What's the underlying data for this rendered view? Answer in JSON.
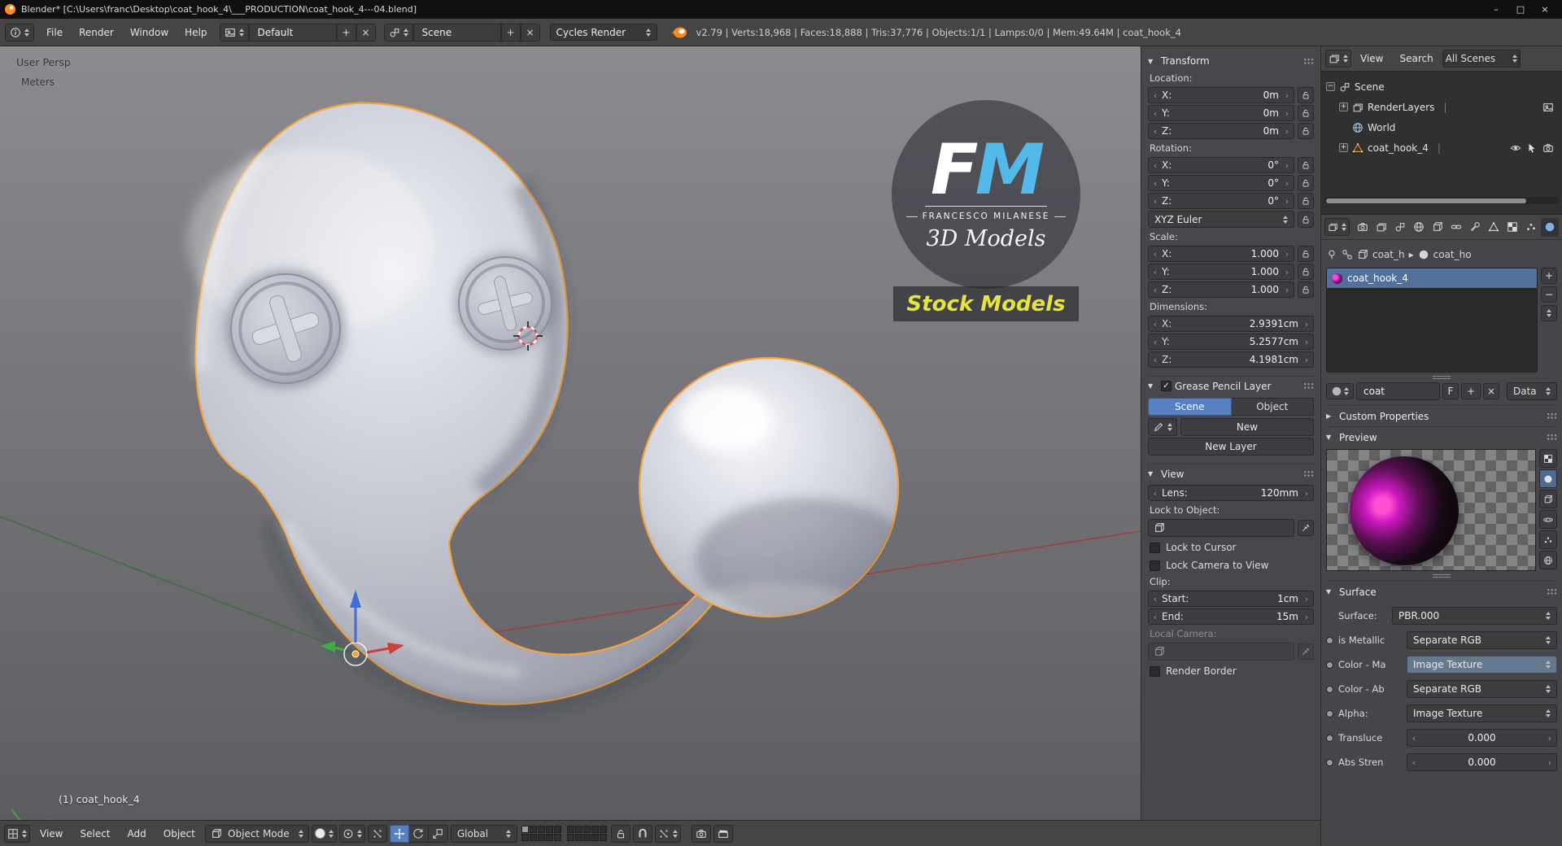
{
  "window": {
    "title": "Blender* [C:\\Users\\franc\\Desktop\\coat_hook_4\\___PRODUCTION\\coat_hook_4---04.blend]",
    "minimize": "–",
    "maximize": "□",
    "close": "×"
  },
  "sym": {
    "plus": "+",
    "minus": "−",
    "close": "×",
    "lt": "‹",
    "gt": "›",
    "tri_down": "▼",
    "tri_right": "▶",
    "crumb": "▸",
    "check": "✓",
    "f": "F"
  },
  "infobar": {
    "menus": [
      "File",
      "Render",
      "Window",
      "Help"
    ],
    "layout": "Default",
    "scene": "Scene",
    "engine": "Cycles Render",
    "stats": "v2.79 | Verts:18,968 | Faces:18,888 | Tris:37,776 | Objects:1/1 | Lamps:0/0 | Mem:49.64M | coat_hook_4"
  },
  "viewport": {
    "view_label": "User Persp",
    "units": "Meters",
    "object_info": "(1) coat_hook_4",
    "watermark": {
      "f": "F",
      "m": "M",
      "name": "FRANCESCO MILANESE",
      "tagline": "3D Models",
      "stock": "Stock Models"
    }
  },
  "vheader": {
    "menus": [
      "View",
      "Select",
      "Add",
      "Object"
    ],
    "mode": "Object Mode",
    "orientation": "Global"
  },
  "npanel": {
    "transform_title": "Transform",
    "location_label": "Location:",
    "loc": [
      {
        "a": "X:",
        "v": "0m"
      },
      {
        "a": "Y:",
        "v": "0m"
      },
      {
        "a": "Z:",
        "v": "0m"
      }
    ],
    "rotation_label": "Rotation:",
    "rot": [
      {
        "a": "X:",
        "v": "0°"
      },
      {
        "a": "Y:",
        "v": "0°"
      },
      {
        "a": "Z:",
        "v": "0°"
      }
    ],
    "euler": "XYZ Euler",
    "scale_label": "Scale:",
    "scl": [
      {
        "a": "X:",
        "v": "1.000"
      },
      {
        "a": "Y:",
        "v": "1.000"
      },
      {
        "a": "Z:",
        "v": "1.000"
      }
    ],
    "dim_label": "Dimensions:",
    "dim": [
      {
        "a": "X:",
        "v": "2.9391cm"
      },
      {
        "a": "Y:",
        "v": "5.2577cm"
      },
      {
        "a": "Z:",
        "v": "4.1981cm"
      }
    ],
    "gp_title": "Grease Pencil Layer",
    "gp_tabs": [
      "Scene",
      "Object"
    ],
    "gp_new": "New",
    "gp_new_layer": "New Layer",
    "view_title": "View",
    "lens_label": "Lens:",
    "lens_value": "120mm",
    "lock_obj_label": "Lock to Object:",
    "lock_cursor": "Lock to Cursor",
    "lock_cam": "Lock Camera to View",
    "clip_label": "Clip:",
    "clip_start_label": "Start:",
    "clip_start": "1cm",
    "clip_end_label": "End:",
    "clip_end": "15m",
    "local_cam_label": "Local Camera:",
    "render_border": "Render Border"
  },
  "outliner": {
    "menus": [
      "View",
      "Search"
    ],
    "scope": "All Scenes",
    "items": [
      {
        "label": "Scene"
      },
      {
        "label": "RenderLayers"
      },
      {
        "label": "World"
      },
      {
        "label": "coat_hook_4"
      }
    ]
  },
  "props": {
    "path_obj": "coat_h",
    "path_mat": "coat_ho",
    "slot_name": "coat_hook_4",
    "mat_name": "coat",
    "data_btn": "Data",
    "custom_props": "Custom Properties",
    "preview": "Preview",
    "surface_title": "Surface",
    "surface_label": "Surface:",
    "surface_value": "PBR.000",
    "rows": [
      {
        "label": "is Metallic",
        "value": "Separate RGB"
      },
      {
        "label": "Color - Ma",
        "value": "Image Texture"
      },
      {
        "label": "Color - Ab",
        "value": "Separate RGB"
      },
      {
        "label": "Alpha:",
        "value": "Image Texture"
      },
      {
        "label": "Transluce",
        "value": "0.000"
      },
      {
        "label": "Abs Stren",
        "value": "0.000"
      }
    ]
  }
}
